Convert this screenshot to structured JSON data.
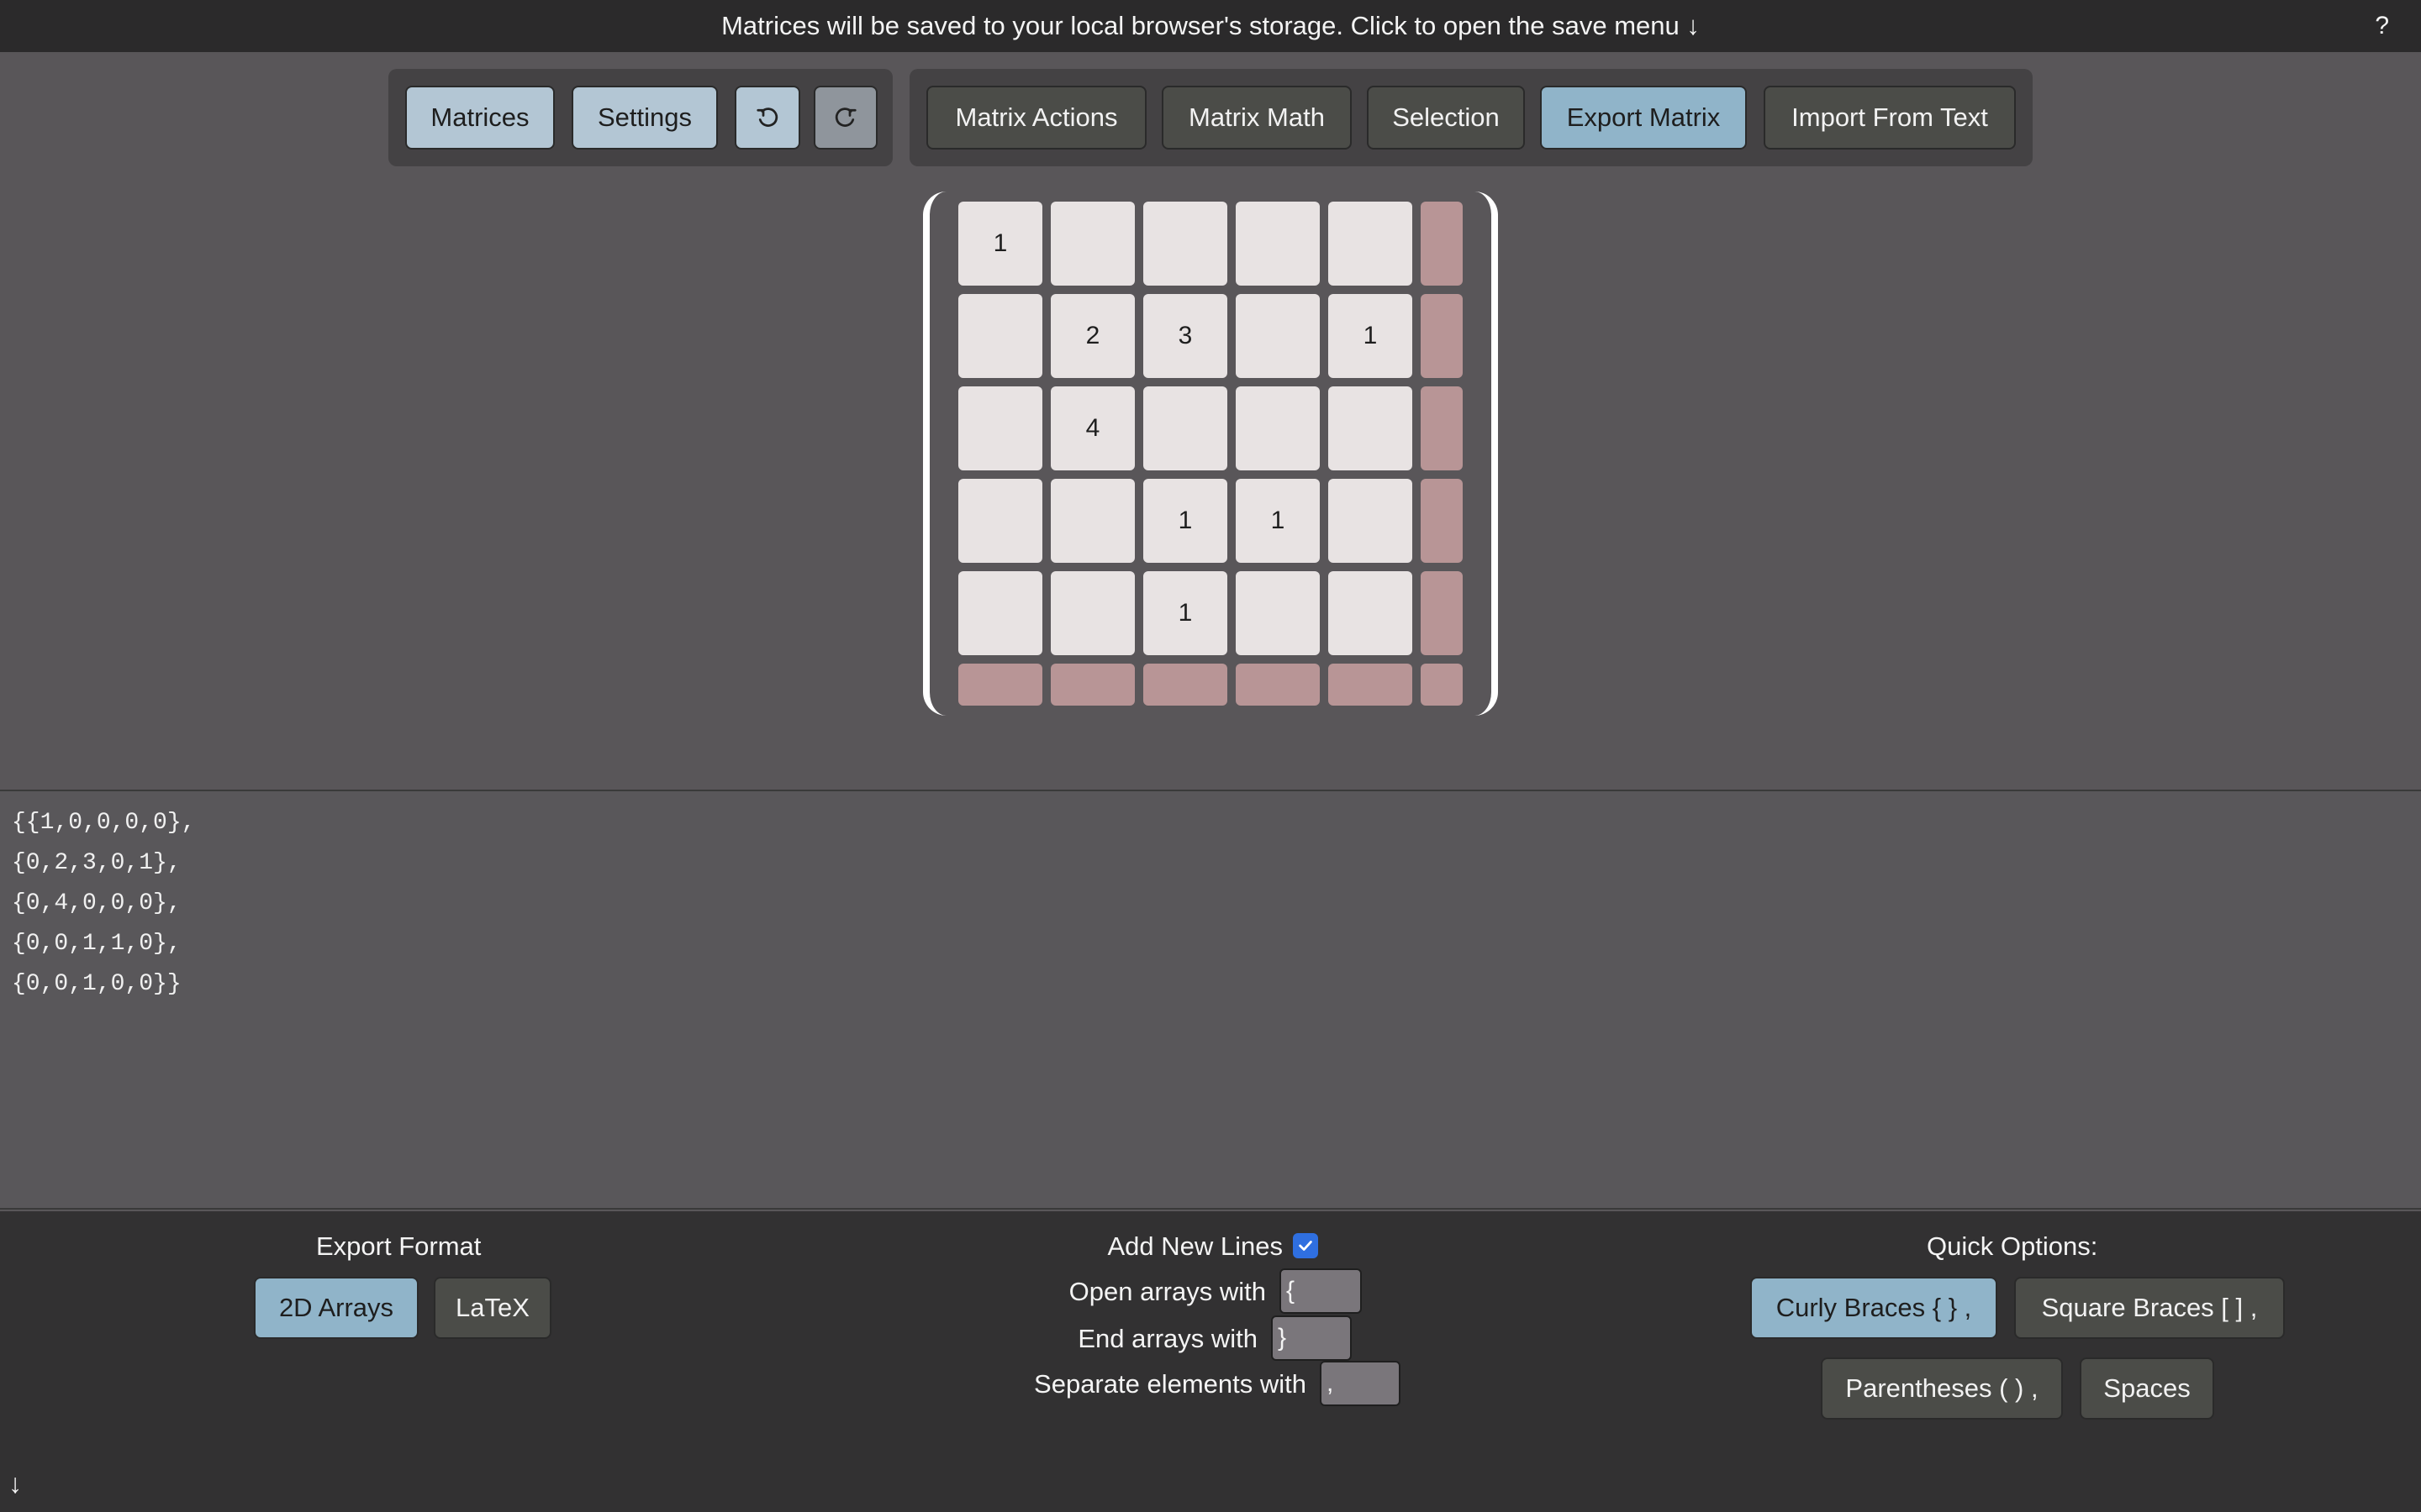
{
  "banner": {
    "text": "Matrices will be saved to your local browser's storage. Click to open the save menu ↓",
    "help": "?"
  },
  "toolbar": {
    "matrices": "Matrices",
    "settings": "Settings",
    "undo_icon": "undo-icon",
    "redo_icon": "redo-icon",
    "tabs": [
      "Matrix Actions",
      "Matrix Math",
      "Selection",
      "Export Matrix",
      "Import From Text"
    ],
    "active_tab": "Export Matrix"
  },
  "matrix": {
    "rows": [
      [
        "1",
        "",
        "",
        "",
        ""
      ],
      [
        "",
        "2",
        "3",
        "",
        "1"
      ],
      [
        "",
        "4",
        "",
        "",
        ""
      ],
      [
        "",
        "",
        "1",
        "1",
        ""
      ],
      [
        "",
        "",
        "1",
        "",
        ""
      ]
    ]
  },
  "export_text": [
    "{{1,0,0,0,0},",
    "{0,2,3,0,1},",
    "{0,4,0,0,0},",
    "{0,0,1,1,0},",
    "{0,0,1,0,0}}"
  ],
  "export_format": {
    "title": "Export Format",
    "options": [
      "2D Arrays",
      "LaTeX"
    ],
    "selected": "2D Arrays"
  },
  "array_options": {
    "add_new_lines_label": "Add New Lines",
    "add_new_lines": true,
    "open_label": "Open arrays with",
    "open_value": "{",
    "end_label": "End arrays with",
    "end_value": "}",
    "separate_label": "Separate elements with",
    "separate_value": ","
  },
  "quick_options": {
    "title": "Quick Options:",
    "curly": "Curly Braces { } ,",
    "square": "Square Braces [ ] ,",
    "parens": "Parentheses ( ) ,",
    "spaces": "Spaces",
    "selected": "Curly Braces { } ,"
  },
  "footer": {
    "arrow": "↓"
  },
  "colors": {
    "active": "#90b4c9",
    "cell": "#e8e3e3",
    "ghost": "#b89596",
    "checkbox": "#2f6fe0"
  }
}
